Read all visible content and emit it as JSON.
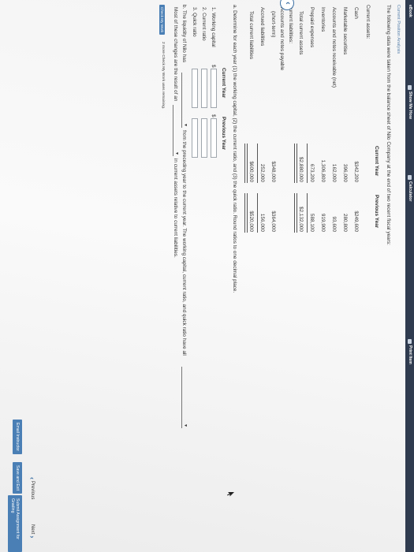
{
  "toolbar": {
    "ebook": "eBook",
    "show_me_how": "Show Me How",
    "calculator": "Calculator",
    "print_item": "Print Item"
  },
  "header": {
    "section_title": "Current Position Analysis",
    "intro": "The following data were taken from the balance sheet of Nilo Company at the end of two recent fiscal years:"
  },
  "balance_sheet": {
    "col_current": "Current Year",
    "col_previous": "Previous Year",
    "current_assets_heading": "Current assets:",
    "assets": [
      {
        "label": "Cash",
        "current": "$342,200",
        "previous": "$249,600"
      },
      {
        "label": "Marketable securities",
        "current": "396,000",
        "previous": "280,800"
      },
      {
        "label": "Accounts and notes receivable (net)",
        "current": "162,000",
        "previous": "93,600"
      },
      {
        "label": "Inventories",
        "current": "1,306,800",
        "previous": "919,900"
      },
      {
        "label": "Prepaid expenses",
        "current": "673,200",
        "previous": "588,100"
      }
    ],
    "total_assets": {
      "label": "Total current assets",
      "current": "$2,880,000",
      "previous": "$2,132,000"
    },
    "current_liabilities_heading": "Current liabilities:",
    "liab_notes_label_1": "Accounts and notes payable",
    "liab_notes_label_2": "(short-term)",
    "liab_notes_current": "$348,000",
    "liab_notes_previous": "$364,000",
    "accrued": {
      "label": "Accrued liabilities",
      "current": "252,000",
      "previous": "156,000"
    },
    "total_liab": {
      "label": "Total current liabilities",
      "current": "$600,000",
      "previous": "$520,000"
    }
  },
  "question_a": {
    "prompt": "a.  Determine for each year (1) the working capital, (2) the current ratio, and (3) the quick ratio. Round ratios to one decimal place.",
    "col_current": "Current Year",
    "col_previous": "Previous Year",
    "rows": [
      {
        "label": "1.  Working capital",
        "prefix_current": "$",
        "prefix_previous": "$"
      },
      {
        "label": "2.  Current ratio"
      },
      {
        "label": "3.  Quick ratio"
      }
    ]
  },
  "question_b": {
    "line1_a": "b.  The liquidity of Nilo has",
    "line1_b": "from the preceding year to the current year. The working capital, current ratio, and quick ratio have all",
    "line2_a": "Most of these changes are the result of an",
    "line2_b": "in current assets relative to current liabilities."
  },
  "check_work": {
    "button": "Check My Work",
    "remaining": "2 more Check My Work uses remaining."
  },
  "footer": {
    "email": "Email Instructor",
    "save": "Save and Exit",
    "submit": "Submit Assignment for Grading",
    "previous": "Previous",
    "next": "Next"
  },
  "colors": {
    "toolbar": "#2f3b4f",
    "button": "#4a7fb5",
    "link": "#5b83ad"
  }
}
